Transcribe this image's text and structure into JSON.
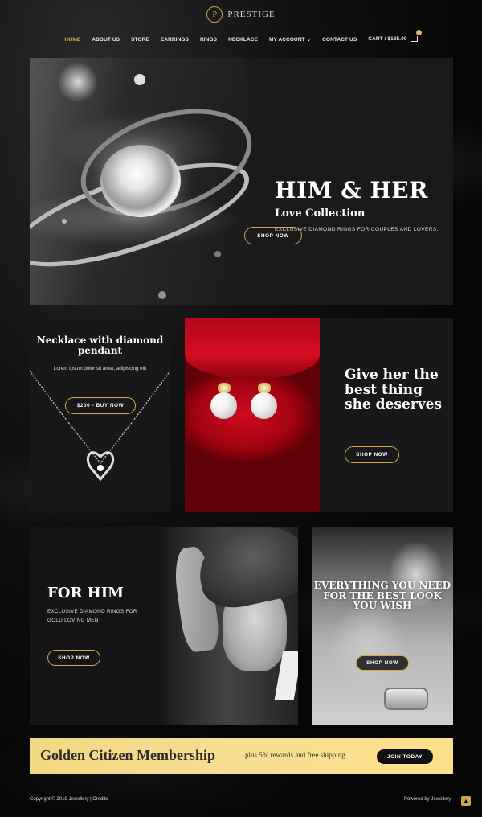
{
  "brand": {
    "logo_letter": "P",
    "name": "PRESTIGE"
  },
  "nav": {
    "items": [
      {
        "label": "HOME"
      },
      {
        "label": "ABOUT US"
      },
      {
        "label": "STORE"
      },
      {
        "label": "EARRINGS"
      },
      {
        "label": "RINGS"
      },
      {
        "label": "NECKLACE"
      },
      {
        "label": "MY ACCOUNT"
      },
      {
        "label": "CONTACT US"
      }
    ],
    "dropdown_glyph": "⌄",
    "cart_label": "CART / $185.00",
    "cart_count": "1"
  },
  "hero": {
    "title": "HIM & HER",
    "subtitle": "Love Collection",
    "description": "EXCLUSIVE DIAMOND RINGS FOR COUPLES AND LOVERS.",
    "button": "SHOP NOW"
  },
  "necklace": {
    "title": "Necklace with diamond pendant",
    "description": "Lorem ipsum dolor sit amet, adipiscing elit",
    "button": "$200 - BUY NOW"
  },
  "earrings": {
    "title": "Give her the best thing she deserves",
    "button": "SHOP NOW"
  },
  "for_him": {
    "title": "FOR HIM",
    "description": "EXCLUSIVE DIAMOND RINGS FOR GOLD LOVING MEN",
    "button": "SHOP NOW"
  },
  "everything": {
    "title": "EVERYTHING YOU NEED FOR THE BEST LOOK YOU WISH",
    "button": "SHOP NOW"
  },
  "membership": {
    "title": "Golden Citizen Membership",
    "subtitle": "plus 5% rewards and free shipping",
    "button": "JOIN TODAY"
  },
  "footer": {
    "copyright": "Copyright © 2019 Jewellery | Credits",
    "powered": "Powered by Jewellery",
    "scroll_glyph": "▲"
  },
  "colors": {
    "accent_gold": "#c9a94a",
    "active_nav": "#d6b25a",
    "background": "#0c0c0c",
    "panel": "#19191b",
    "membership_bg": "#f5dc8d"
  }
}
